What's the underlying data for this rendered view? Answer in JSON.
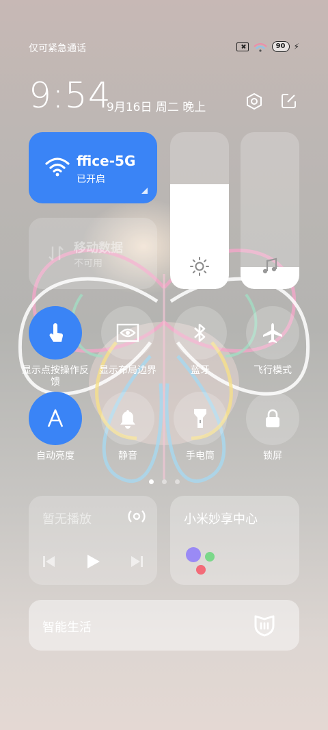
{
  "status": {
    "carrier": "仅可紧急通话",
    "battery": "90"
  },
  "header": {
    "time": "9:54",
    "date": "9月16日 周二 晚上"
  },
  "wifi_tile": {
    "name": "ffice-5G",
    "state": "已开启"
  },
  "mobile_tile": {
    "name": "移动数据",
    "state": "不可用"
  },
  "sliders": {
    "brightness_level": 0.67,
    "volume_level": 0.14
  },
  "toggles": [
    {
      "label": "显示点按操作反馈",
      "icon": "touch-icon",
      "on": true
    },
    {
      "label": "显示布局边界",
      "icon": "eye-icon",
      "on": false
    },
    {
      "label": "蓝牙",
      "icon": "bluetooth-icon",
      "on": false
    },
    {
      "label": "飞行模式",
      "icon": "airplane-icon",
      "on": false
    },
    {
      "label": "自动亮度",
      "icon": "auto-brightness-icon",
      "on": true
    },
    {
      "label": "静音",
      "icon": "bell-icon",
      "on": false
    },
    {
      "label": "手电筒",
      "icon": "flashlight-icon",
      "on": false
    },
    {
      "label": "锁屏",
      "icon": "lock-icon",
      "on": false
    }
  ],
  "pager": {
    "pages": 3,
    "active": 0
  },
  "media": {
    "title": "暂无播放"
  },
  "share": {
    "title": "小米妙享中心"
  },
  "smart_life": {
    "title": "智能生活"
  },
  "colors": {
    "accent": "#3a84f6"
  }
}
